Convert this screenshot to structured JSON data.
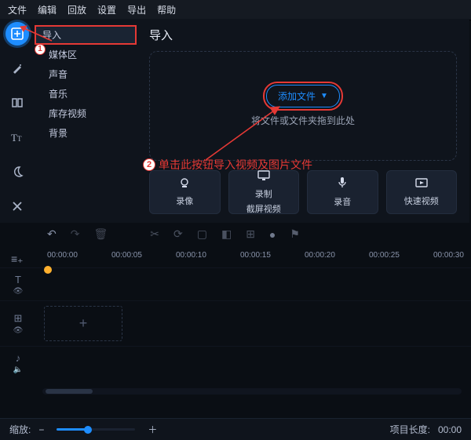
{
  "menu": [
    "文件",
    "编辑",
    "回放",
    "设置",
    "导出",
    "帮助"
  ],
  "tree": {
    "root": "导入",
    "items": [
      "媒体区",
      "声音",
      "音乐",
      "库存视频",
      "背景"
    ]
  },
  "main": {
    "title": "导入",
    "add_label": "添加文件",
    "drop_hint": "将文件或文件夹拖到此处"
  },
  "annotations": {
    "num1": "1",
    "num2": "2",
    "text2": "单击此按钮导入视频及图片文件"
  },
  "tools": [
    {
      "label": "录像"
    },
    {
      "label_a": "录制",
      "label_b": "截屏视频"
    },
    {
      "label": "录音"
    },
    {
      "label": "快速视频"
    }
  ],
  "ruler": [
    "00:00:00",
    "00:00:05",
    "00:00:10",
    "00:00:15",
    "00:00:20",
    "00:00:25",
    "00:00:30"
  ],
  "status": {
    "zoom_label": "缩放:",
    "length_label": "项目长度:",
    "length_value": "00:00"
  }
}
